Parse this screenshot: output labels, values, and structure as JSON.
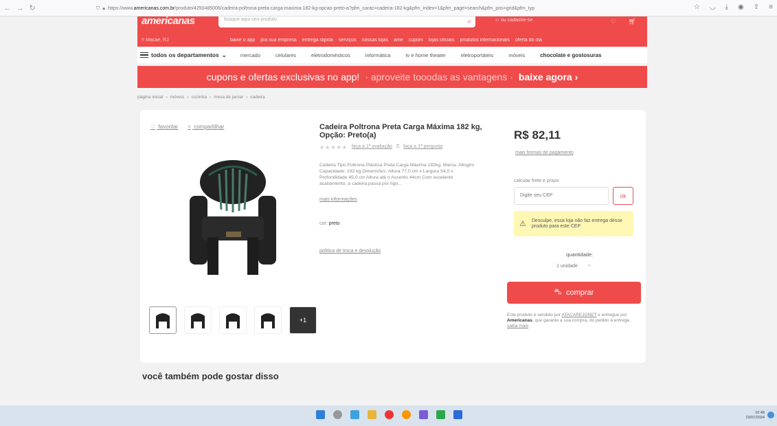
{
  "browser": {
    "url_prefix": "https://www.",
    "url_domain": "americanas.com.br",
    "url_rest": "/produto/4250485006/cadeira-poltrona-preta-carga-maxima-182-kg-opcao-preto-a?pfm_carac=cadeira-182-kg&pfm_index=1&pfm_page=search&pfm_pos=grid&pfm_typ"
  },
  "header": {
    "logo": "americanas",
    "search_placeholder": "busque aqui seu produto",
    "user_text": "ou cadastre-se",
    "location": "Macaé, RJ",
    "quicklinks": [
      "baixe o app",
      "pra sua empresa",
      "entrega rápida",
      "serviços",
      "nossas lojas",
      "ame",
      "cupom",
      "lojas oficiais",
      "produtos internacionais",
      "oferta do dia"
    ]
  },
  "categories": {
    "all_label": "todos os departamentos",
    "items": [
      "mercado",
      "celulares",
      "eletrodomésticos",
      "informática",
      "tv e home theater",
      "eletroportáteis",
      "móveis"
    ],
    "highlight": "chocolate e gostosuras"
  },
  "promo": {
    "part1": "cupons e ofertas exclusivas no app!",
    "part2": "· aproveite tooodas as vantagens ·",
    "part3": "baixe agora ›"
  },
  "breadcrumb": [
    "página inicial",
    "móveis",
    "cozinha",
    "mesa de jantar",
    "cadeira"
  ],
  "product": {
    "favorite": "favoritar",
    "share": "compartilhar",
    "title": "Cadeira Poltrona Preta Carga Máxima 182 kg, Opção: Preto(a)",
    "review_link": "faça a 1ª avaliação",
    "question_link": "faça a 1ª pergunta",
    "description": "Cadeira Tipo Poltrona Plástica Preta Carga Máxima 182kg. Marca: Altogiro Capacidade: 182 kg Dimensões: Altura 77,0 cm x Largura 54,0 x Profundidade 45,0 cm Altura até o Assento 44cm Com excelente acabamento, a cadeira passa por rigo...",
    "more_info": "mais informações",
    "color_label": "cor:",
    "color_value": "preto",
    "policy": "política de troca e devolução",
    "more_thumbs": "+1"
  },
  "buybox": {
    "price": "R$ 82,11",
    "payment": "mais formas de pagamento",
    "shipping_label": "calcular frete e prazo",
    "cep_placeholder": "Digite seu CEP",
    "ok": "ok",
    "warning": "Desculpe, essa loja não faz entrega desse produto para este CEP",
    "qty_label": "quantidade:",
    "qty_value": "1 unidade",
    "buy": "comprar",
    "seller_pre": "Este produto é vendido por",
    "seller_name": "ATACAREJONET",
    "seller_mid": "e entregue por",
    "seller_ship": "Americanas",
    "seller_post": ", que garante a sua compra, do pedido à entrega.",
    "seller_more": "saiba mais"
  },
  "suggest_title": "você também pode gostar disso",
  "taskbar": {
    "time": "10:48",
    "date": "23/07/2024"
  }
}
